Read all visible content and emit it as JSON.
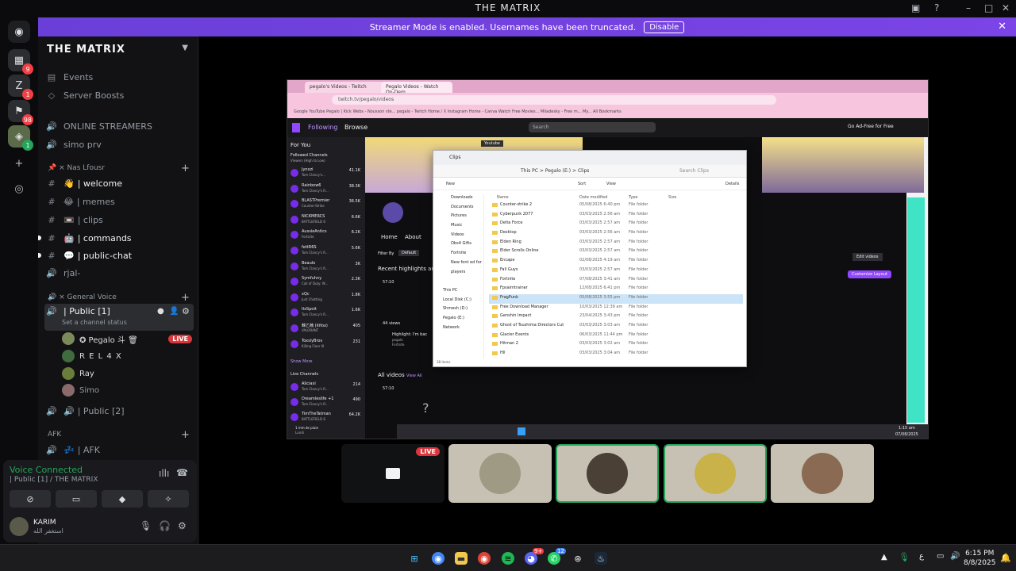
{
  "window": {
    "title": "THE MATRIX"
  },
  "banner": {
    "text": "Streamer Mode is enabled. Usernames have been truncated.",
    "disable_label": "Disable"
  },
  "server": {
    "name": "THE MATRIX"
  },
  "rail": {
    "badges": [
      "9",
      "1",
      "98",
      "1"
    ]
  },
  "sidebar": {
    "events": "Events",
    "boosts": "Server Boosts",
    "online_streamers": "ONLINE STREAMERS",
    "simo_prv": "simo prv",
    "cat_text": "📌 × Nas Lfousr",
    "channels": [
      {
        "prefix": "👋",
        "name": "| welcome"
      },
      {
        "prefix": "😂",
        "name": "| memes"
      },
      {
        "prefix": "📼",
        "name": "| clips"
      },
      {
        "prefix": "🤖",
        "name": "| commands"
      },
      {
        "prefix": "💬",
        "name": "| public-chat"
      }
    ],
    "rjal": "rjal-",
    "cat_voice": "🔊 × General Voice",
    "public1": "| Public [1]",
    "channel_status": "Set a channel status",
    "members": [
      {
        "name": "✪ Pegalo 斗 🗑",
        "live": "LIVE"
      },
      {
        "name": "R E L 4 X"
      },
      {
        "name": "Ray"
      },
      {
        "name": "Simo"
      }
    ],
    "public2": "| Public [2]",
    "cat_afk": "AFK",
    "afk": "| AFK"
  },
  "voice": {
    "status": "Voice Connected",
    "where": "| Public [1] / THE MATRIX"
  },
  "user": {
    "name": "KARIM",
    "sub": "استغفر الله"
  },
  "stream": {
    "tabs": [
      "pegalo's Videos - Twitch",
      "Pegalo Videos - Watch On-Dem"
    ],
    "url": "twitch.tv/pegalo/videos",
    "bookmarks": "Google  YouTube  Pegalo | Kick  Webs - Nousson ste...  pegalo - Twitch  Home / X  Instagram  Home - Canva  Watch Free Movies...  Miladesky - Free m...  My...  All Bookmarks",
    "nav": {
      "following": "Following",
      "browse": "Browse",
      "search": "Search",
      "ad_free": "Go Ad-Free for Free"
    },
    "for_you": "For You",
    "followed": "Followed Channels",
    "followed_sub": "Viewers (High to Low)",
    "channels": [
      {
        "name": "Jynxzi",
        "game": "Tom Clancy's...",
        "viewers": "41.1K"
      },
      {
        "name": "Rainbow6",
        "game": "Tom Clancy's R...",
        "viewers": "38.3K"
      },
      {
        "name": "BLASTPremier",
        "game": "Counter-Strike",
        "viewers": "36.5K"
      },
      {
        "name": "NICKMERCS",
        "game": "BATTLEFIELD 6",
        "viewers": "6.6K"
      },
      {
        "name": "AussieAntics",
        "game": "Fortnite",
        "viewers": "6.2K"
      },
      {
        "name": "fettR6S",
        "game": "Tom Clancy's R...",
        "viewers": "5.6K"
      },
      {
        "name": "Beaulo",
        "game": "Tom Clancy's R...",
        "viewers": "3K"
      },
      {
        "name": "Symfuhny",
        "game": "Call of Duty: W...",
        "viewers": "2.3K"
      },
      {
        "name": "xQc",
        "game": "Just Chatting",
        "viewers": "1.8K"
      },
      {
        "name": "ItsSpoit",
        "game": "Tom Clancy's R...",
        "viewers": "1.6K"
      },
      {
        "name": "韓乙楠 (itifox)",
        "game": "VALORANT",
        "viewers": "405"
      },
      {
        "name": "ToxsiyBros",
        "game": "Killing Floor III",
        "viewers": "231"
      }
    ],
    "show_more": "Show More",
    "live_channels": "Live Channels",
    "live": [
      {
        "name": "Aliciaxi",
        "game": "Tom Clancy's R...",
        "viewers": "214"
      },
      {
        "name": "Dreamleslife +1",
        "game": "Tom Clancy's R...",
        "viewers": "490"
      },
      {
        "name": "TimTheTatman",
        "game": "BATTLEFIELD 6",
        "viewers": "64.2K"
      }
    ],
    "youtube": "Youtube",
    "home": "Home",
    "about": "About",
    "filter_by": "Filter By",
    "filter_default": "Default",
    "recent_highlights": "Recent highlights an",
    "duration1": "57:10",
    "views": "44 views",
    "highlight": "Highlight: I'm bac",
    "highlight_ch": "pegalo",
    "highlight_game": "Fortnite",
    "all_videos": "All videos",
    "view_all": "View All",
    "duration2": "57:10",
    "edit_videos": "Edit videos",
    "customize": "Customize Layout",
    "explorer": {
      "title": "Clips",
      "path": "This PC  >  Pegalo (E:)  >  Clips",
      "search": "Search Clips",
      "new": "New",
      "sort": "Sort",
      "view": "View",
      "details": "Details",
      "left": [
        "Downloads",
        "Documents",
        "Pictures",
        "Music",
        "Videos",
        "Obs4 Gifts",
        "Fortnite",
        "New font ed for",
        "players",
        "",
        "This PC",
        "Local Disk (C:)",
        "Shmesh (D:)",
        "Pegalo (E:)",
        "Network"
      ],
      "cols": {
        "name": "Name",
        "date": "Date modified",
        "type": "Type",
        "size": "Size"
      },
      "files": [
        {
          "n": "Counter-strike 2",
          "d": "05/08/2025 6:40 pm",
          "t": "File folder"
        },
        {
          "n": "Cyberpunk 2077",
          "d": "03/03/2025 2:56 am",
          "t": "File folder"
        },
        {
          "n": "Delta Force",
          "d": "03/03/2025 2:57 am",
          "t": "File folder"
        },
        {
          "n": "Desktop",
          "d": "03/03/2025 2:56 am",
          "t": "File folder"
        },
        {
          "n": "Elden Ring",
          "d": "03/03/2025 2:57 am",
          "t": "File folder"
        },
        {
          "n": "Elder Scrolls Online",
          "d": "03/03/2025 2:57 am",
          "t": "File folder"
        },
        {
          "n": "Encape",
          "d": "02/08/2025 4:19 am",
          "t": "File folder"
        },
        {
          "n": "Fall Guys",
          "d": "03/03/2025 2:57 am",
          "t": "File folder"
        },
        {
          "n": "Fortnite",
          "d": "07/08/2025 3:41 am",
          "t": "File folder"
        },
        {
          "n": "Fpsaimtrainer",
          "d": "12/08/2025 6:41 pm",
          "t": "File folder"
        },
        {
          "n": "FragPunk",
          "d": "05/08/2025 3:55 pm",
          "t": "File folder"
        },
        {
          "n": "Free Download Manager",
          "d": "10/03/2025 12:39 am",
          "t": "File folder"
        },
        {
          "n": "Genshin Impact",
          "d": "23/04/2025 3:43 pm",
          "t": "File folder"
        },
        {
          "n": "Ghost of Tsushima Directors Cut",
          "d": "03/03/2025 3:03 am",
          "t": "File folder"
        },
        {
          "n": "Glacier Events",
          "d": "06/03/2025 11:44 pm",
          "t": "File folder"
        },
        {
          "n": "Hitman 2",
          "d": "03/03/2025 3:02 am",
          "t": "File folder"
        },
        {
          "n": "Hll",
          "d": "03/03/2025 3:04 am",
          "t": "File folder"
        }
      ],
      "items": "38 items"
    },
    "taskbar_time": "1:15 am",
    "taskbar_date": "07/08/2025",
    "bottom_left": "1 mm de pluie",
    "bottom_left2": "Lundi"
  },
  "tiles": {
    "live": "LIVE"
  },
  "taskbar": {
    "time": "6:15 PM",
    "date": "8/8/2025",
    "lang": "ع",
    "badge1": "9+",
    "badge2": "12"
  }
}
